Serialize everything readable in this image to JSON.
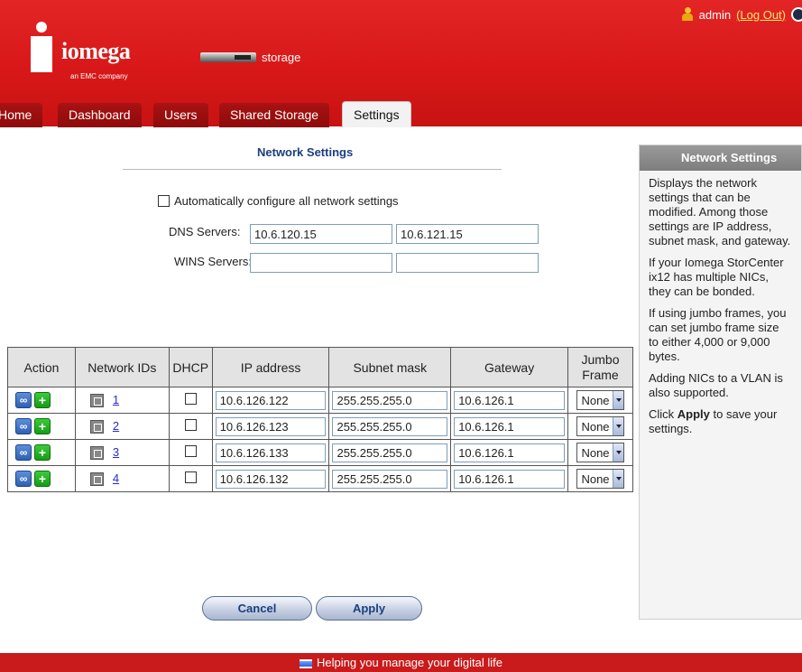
{
  "header": {
    "brand": "iomega",
    "brand_sub": "an EMC company",
    "device_label": "storage",
    "user": "admin",
    "logout_label": "(Log Out)"
  },
  "tabs": [
    {
      "label": "Home",
      "active": false
    },
    {
      "label": "Dashboard",
      "active": false
    },
    {
      "label": "Users",
      "active": false
    },
    {
      "label": "Shared Storage",
      "active": false
    },
    {
      "label": "Settings",
      "active": true
    }
  ],
  "page": {
    "title": "Network Settings",
    "auto_config_label": "Automatically configure all network settings",
    "auto_config_checked": false,
    "dns_label": "DNS Servers:",
    "dns_1": "10.6.120.15",
    "dns_2": "10.6.121.15",
    "wins_label": "WINS Servers:",
    "wins_1": "",
    "wins_2": ""
  },
  "table": {
    "headers": [
      "Action",
      "Network IDs",
      "DHCP",
      "IP address",
      "Subnet mask",
      "Gateway",
      "Jumbo Frame"
    ],
    "rows": [
      {
        "id": "1",
        "dhcp": false,
        "ip": "10.6.126.122",
        "subnet": "255.255.255.0",
        "gateway": "10.6.126.1",
        "jumbo": "None"
      },
      {
        "id": "2",
        "dhcp": false,
        "ip": "10.6.126.123",
        "subnet": "255.255.255.0",
        "gateway": "10.6.126.1",
        "jumbo": "None"
      },
      {
        "id": "3",
        "dhcp": false,
        "ip": "10.6.126.133",
        "subnet": "255.255.255.0",
        "gateway": "10.6.126.1",
        "jumbo": "None"
      },
      {
        "id": "4",
        "dhcp": false,
        "ip": "10.6.126.132",
        "subnet": "255.255.255.0",
        "gateway": "10.6.126.1",
        "jumbo": "None"
      }
    ]
  },
  "buttons": {
    "cancel": "Cancel",
    "apply": "Apply"
  },
  "help": {
    "title": "Network Settings",
    "p1": [
      "Displays the network",
      "settings that can be",
      "modified. Among those",
      "settings are IP address,",
      "subnet mask, and gateway."
    ],
    "p2": [
      "If your Iomega StorCenter",
      "ix12 has multiple NICs,",
      "they can be bonded."
    ],
    "p3": [
      "If using jumbo frames, you",
      "can set jumbo frame size",
      "to either 4,000 or 9,000",
      "bytes."
    ],
    "p4": [
      "Adding NICs to a VLAN is",
      "also supported."
    ],
    "p5_pre": "Click ",
    "p5_bold": "Apply",
    "p5_post": " to save your",
    "p5_line2": "settings."
  },
  "footer": {
    "text": "Helping you manage your digital life"
  },
  "colors": {
    "header_red": "#d81818",
    "footer_red": "#c91b1b",
    "title_blue": "#1b3f7e",
    "link_yellow": "#ffe96b"
  }
}
